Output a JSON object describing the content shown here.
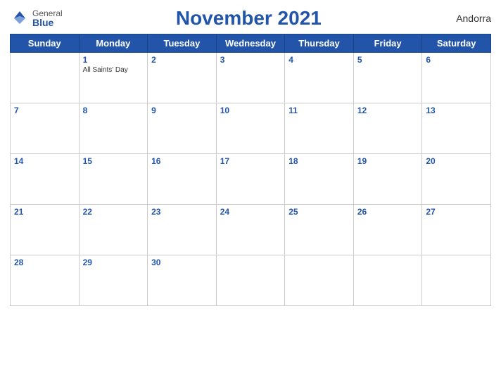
{
  "header": {
    "title": "November 2021",
    "country": "Andorra",
    "logo": {
      "general": "General",
      "blue": "Blue"
    }
  },
  "weekdays": [
    "Sunday",
    "Monday",
    "Tuesday",
    "Wednesday",
    "Thursday",
    "Friday",
    "Saturday"
  ],
  "weeks": [
    [
      {
        "num": "",
        "events": []
      },
      {
        "num": "1",
        "events": [
          "All Saints' Day"
        ]
      },
      {
        "num": "2",
        "events": []
      },
      {
        "num": "3",
        "events": []
      },
      {
        "num": "4",
        "events": []
      },
      {
        "num": "5",
        "events": []
      },
      {
        "num": "6",
        "events": []
      }
    ],
    [
      {
        "num": "7",
        "events": []
      },
      {
        "num": "8",
        "events": []
      },
      {
        "num": "9",
        "events": []
      },
      {
        "num": "10",
        "events": []
      },
      {
        "num": "11",
        "events": []
      },
      {
        "num": "12",
        "events": []
      },
      {
        "num": "13",
        "events": []
      }
    ],
    [
      {
        "num": "14",
        "events": []
      },
      {
        "num": "15",
        "events": []
      },
      {
        "num": "16",
        "events": []
      },
      {
        "num": "17",
        "events": []
      },
      {
        "num": "18",
        "events": []
      },
      {
        "num": "19",
        "events": []
      },
      {
        "num": "20",
        "events": []
      }
    ],
    [
      {
        "num": "21",
        "events": []
      },
      {
        "num": "22",
        "events": []
      },
      {
        "num": "23",
        "events": []
      },
      {
        "num": "24",
        "events": []
      },
      {
        "num": "25",
        "events": []
      },
      {
        "num": "26",
        "events": []
      },
      {
        "num": "27",
        "events": []
      }
    ],
    [
      {
        "num": "28",
        "events": []
      },
      {
        "num": "29",
        "events": []
      },
      {
        "num": "30",
        "events": []
      },
      {
        "num": "",
        "events": []
      },
      {
        "num": "",
        "events": []
      },
      {
        "num": "",
        "events": []
      },
      {
        "num": "",
        "events": []
      }
    ]
  ]
}
